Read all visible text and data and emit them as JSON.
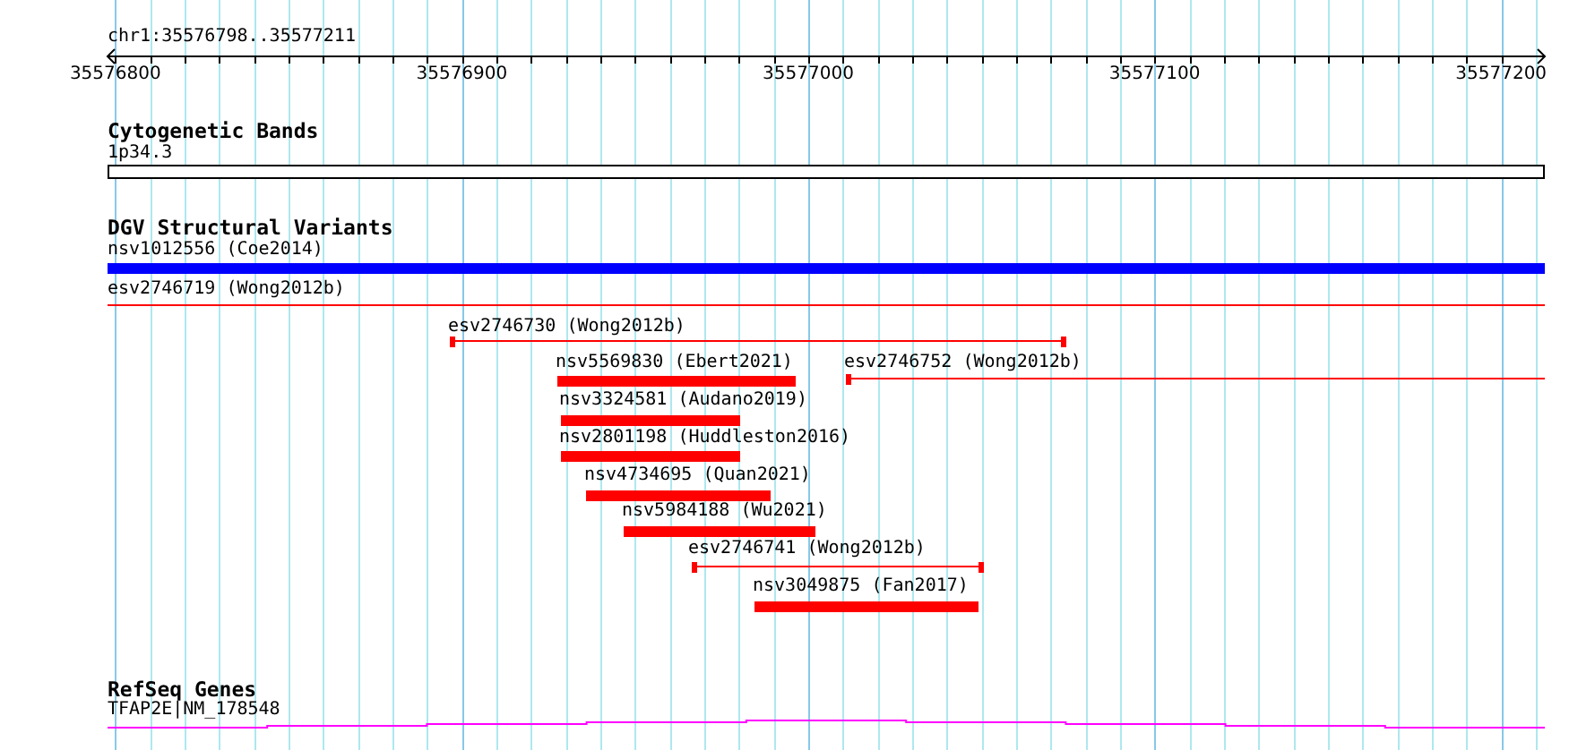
{
  "ruler": {
    "location": "chr1:35576798..35577211",
    "ticks": [
      {
        "label": "35576800"
      },
      {
        "label": "35576900"
      },
      {
        "label": "35577000"
      },
      {
        "label": "35577100"
      },
      {
        "label": "35577200"
      }
    ]
  },
  "tracks": [
    {
      "title": "Cytogenetic Bands",
      "features": [
        {
          "kind": "band",
          "label": "1p34.3"
        }
      ]
    },
    {
      "title": "DGV Structural Variants",
      "features": [
        {
          "kind": "bar",
          "label": "nsv1012556 (Coe2014)",
          "color": "#0000ff"
        },
        {
          "kind": "line",
          "label": "esv2746719 (Wong2012b)",
          "color": "#ff0000"
        },
        {
          "kind": "span",
          "label": "esv2746730 (Wong2012b)",
          "color": "#ff0000"
        },
        {
          "kind": "bar",
          "label": "nsv5569830 (Ebert2021)",
          "color": "#ff0000"
        },
        {
          "kind": "span",
          "label": "esv2746752 (Wong2012b)",
          "color": "#ff0000"
        },
        {
          "kind": "bar",
          "label": "nsv3324581 (Audano2019)",
          "color": "#ff0000"
        },
        {
          "kind": "bar",
          "label": "nsv2801198 (Huddleston2016)",
          "color": "#ff0000"
        },
        {
          "kind": "bar",
          "label": "nsv4734695 (Quan2021)",
          "color": "#ff0000"
        },
        {
          "kind": "bar",
          "label": "nsv5984188 (Wu2021)",
          "color": "#ff0000"
        },
        {
          "kind": "span",
          "label": "esv2746741 (Wong2012b)",
          "color": "#ff0000"
        },
        {
          "kind": "bar",
          "label": "nsv3049875 (Fan2017)",
          "color": "#ff0000"
        }
      ]
    },
    {
      "title": "RefSeq Genes",
      "features": [
        {
          "kind": "gene",
          "label": "TFAP2E|NM_178548"
        }
      ]
    }
  ]
}
